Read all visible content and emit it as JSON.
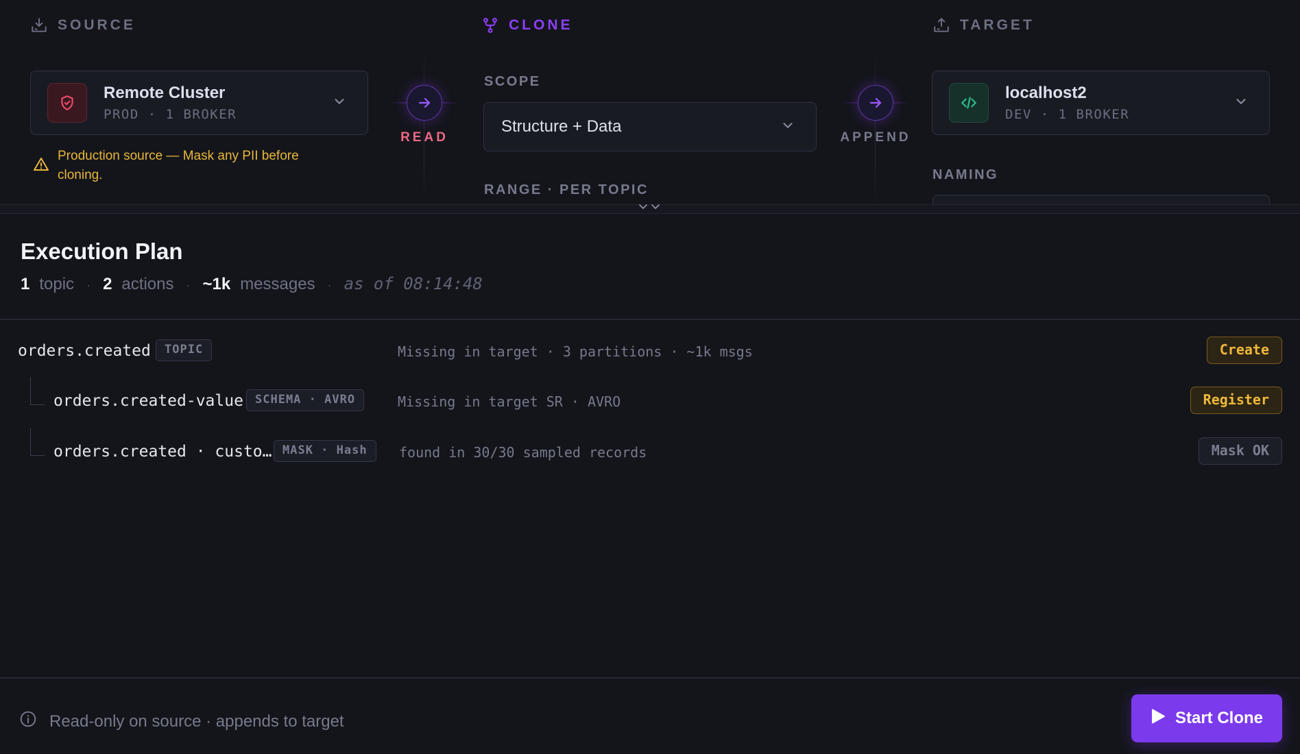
{
  "source": {
    "heading": "SOURCE",
    "icon": "download-tray-icon",
    "cluster_name": "Remote Cluster",
    "cluster_meta": "PROD · 1 BROKER",
    "badge_icon": "shield-icon",
    "warning": "Production source — Mask any PII before cloning."
  },
  "clone": {
    "heading": "CLONE",
    "icon": "fork-icon",
    "scope_label": "SCOPE",
    "scope_value": "Structure + Data",
    "range_label": "RANGE · PER TOPIC"
  },
  "flow": {
    "read_label": "READ",
    "append_label": "APPEND"
  },
  "target": {
    "heading": "TARGET",
    "icon": "upload-tray-icon",
    "cluster_name": "localhost2",
    "cluster_meta": "DEV · 1 BROKER",
    "badge_icon": "code-icon",
    "naming_label": "NAMING"
  },
  "plan": {
    "title": "Execution Plan",
    "topics_count": "1",
    "topics_label": "topic",
    "actions_count": "2",
    "actions_label": "actions",
    "messages_count": "~1k",
    "messages_label": "messages",
    "as_of": "as of 08:14:48",
    "rows": [
      {
        "name": "orders.created",
        "tag": "TOPIC",
        "desc": "Missing in target · 3 partitions · ~1k msgs",
        "action": "Create"
      },
      {
        "name": "orders.created-value",
        "tag": "SCHEMA · AVRO",
        "desc": "Missing in target SR · AVRO",
        "action": "Register"
      },
      {
        "name": "orders.created · custo…",
        "tag": "MASK · Hash",
        "desc": "found in 30/30 sampled records",
        "action": "Mask OK"
      }
    ]
  },
  "footer": {
    "note": "Read-only on source · appends to target",
    "start_label": "Start Clone"
  },
  "colors": {
    "background": "#14151b",
    "accent": "#7c3aed",
    "warning": "#e9b73a",
    "prod": "#ec6a86",
    "dev": "#2fbf8c"
  }
}
